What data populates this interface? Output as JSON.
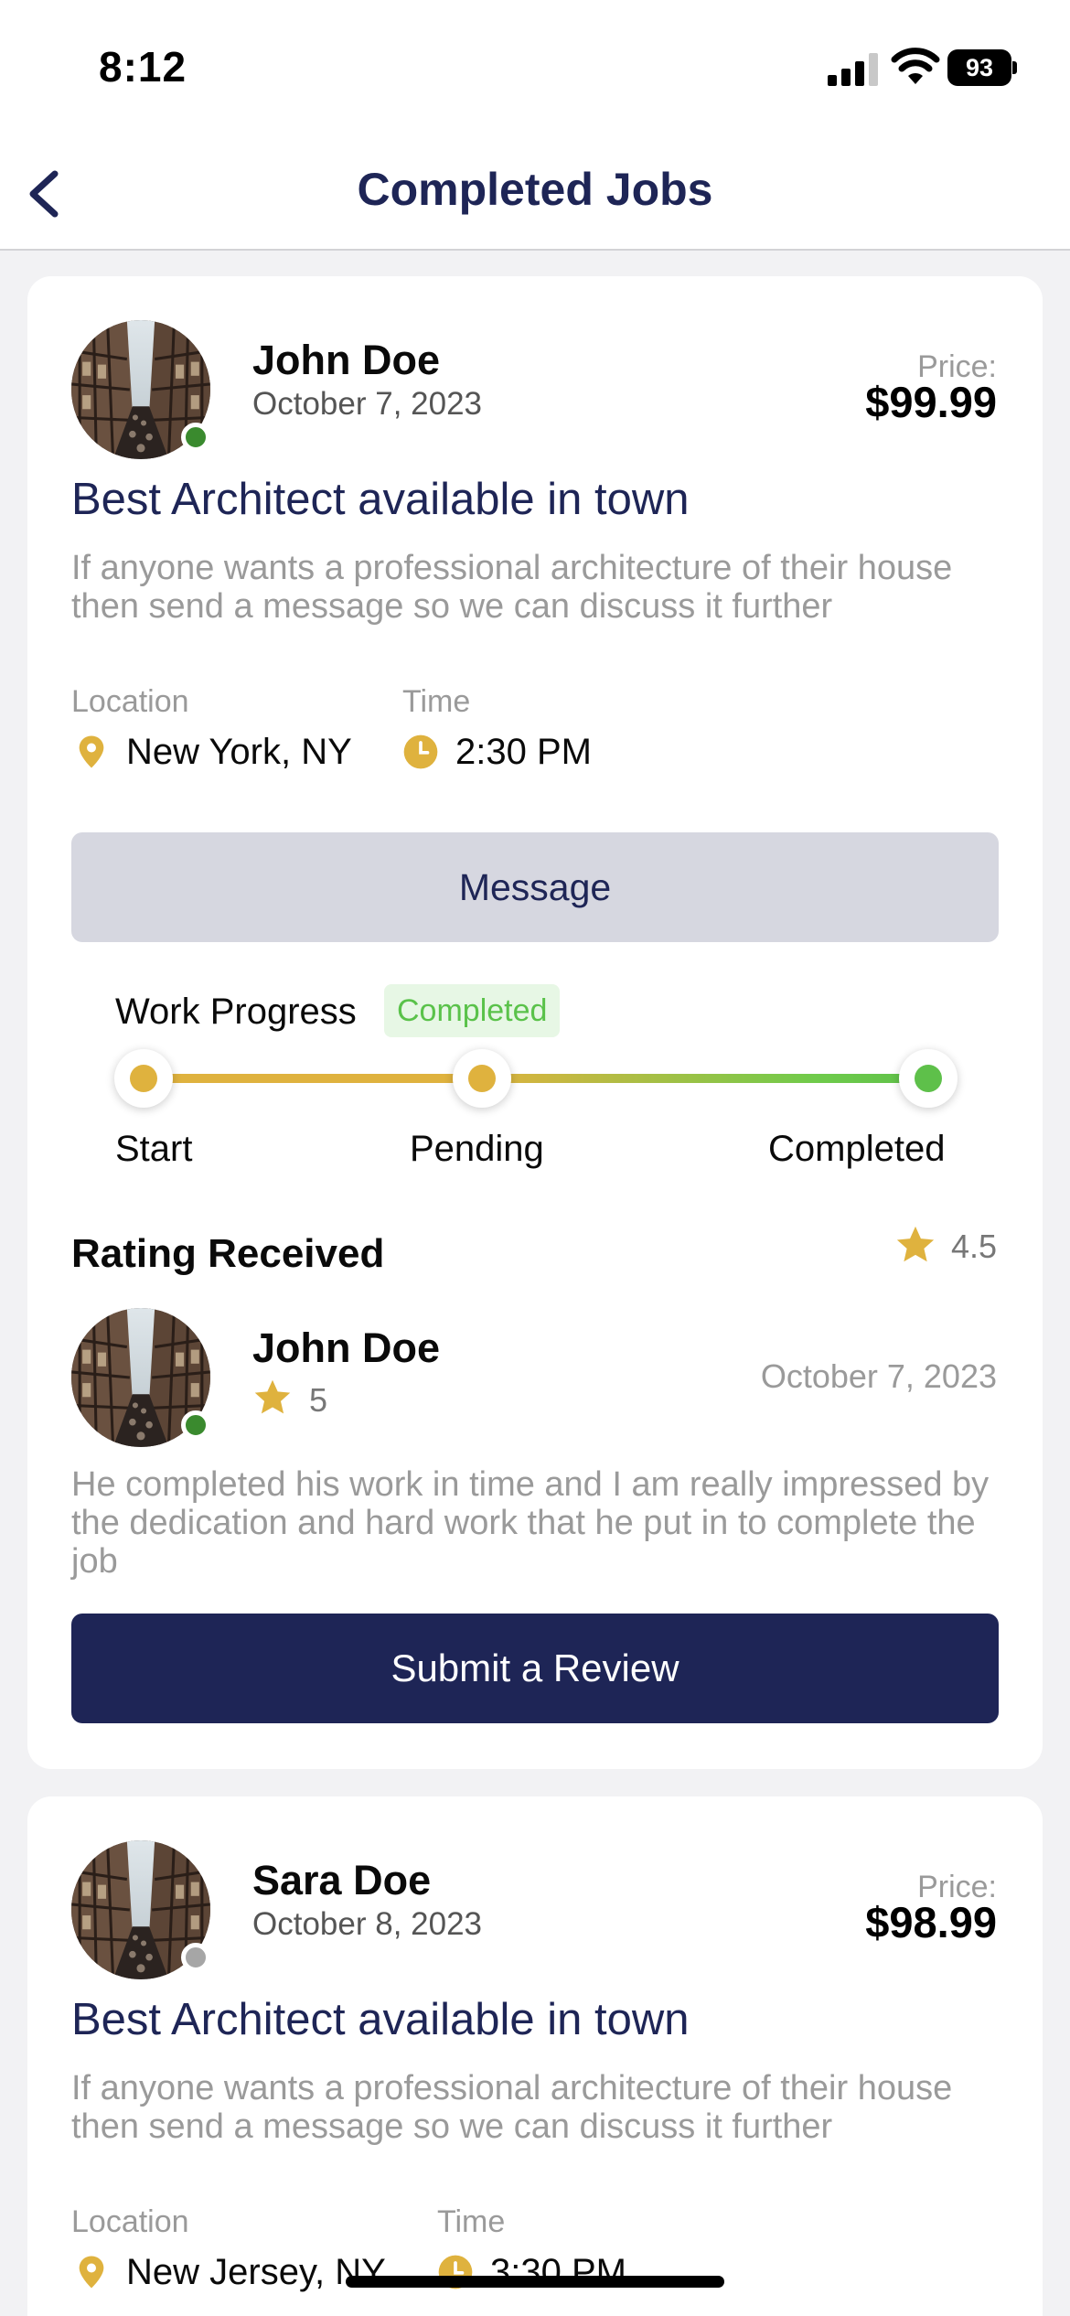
{
  "status_bar": {
    "time": "8:12",
    "battery": "93"
  },
  "header": {
    "title": "Completed Jobs"
  },
  "jobs": [
    {
      "name": "John Doe",
      "date": "October 7, 2023",
      "price_label": "Price:",
      "price": "$99.99",
      "title": "Best Architect available in town",
      "description": "If anyone wants a professional architecture of their house then send a message so we can discuss it further",
      "location_label": "Location",
      "location": "New York, NY",
      "time_label": "Time",
      "time": "2:30 PM",
      "online": true,
      "message_button": "Message",
      "progress": {
        "label": "Work Progress",
        "status": "Completed",
        "steps": [
          "Start",
          "Pending",
          "Completed"
        ]
      },
      "rating": {
        "title": "Rating Received",
        "overall": "4.5",
        "reviewer": {
          "name": "John Doe",
          "rating": "5",
          "date": "October 7, 2023"
        },
        "review_text": "He completed his work in time and I am really impressed by the dedication and hard work that he put in to complete the job"
      },
      "submit_button": "Submit a Review"
    },
    {
      "name": "Sara Doe",
      "date": "October 8, 2023",
      "price_label": "Price:",
      "price": "$98.99",
      "title": "Best Architect available in town",
      "description": "If anyone wants a professional architecture of their house then send a message so we can discuss it further",
      "location_label": "Location",
      "location": "New Jersey, NY",
      "time_label": "Time",
      "time": "3:30 PM",
      "online": false
    }
  ],
  "colors": {
    "brand_navy": "#1e2556",
    "gold": "#dfb23e",
    "green": "#5ec04a",
    "online": "#3a8a2e",
    "offline": "#a6a6a6",
    "muted_text": "#9a9a9a"
  },
  "icons": [
    "back-chevron-icon",
    "signal-icon",
    "wifi-icon",
    "battery-icon",
    "location-pin-icon",
    "clock-icon",
    "star-icon"
  ]
}
